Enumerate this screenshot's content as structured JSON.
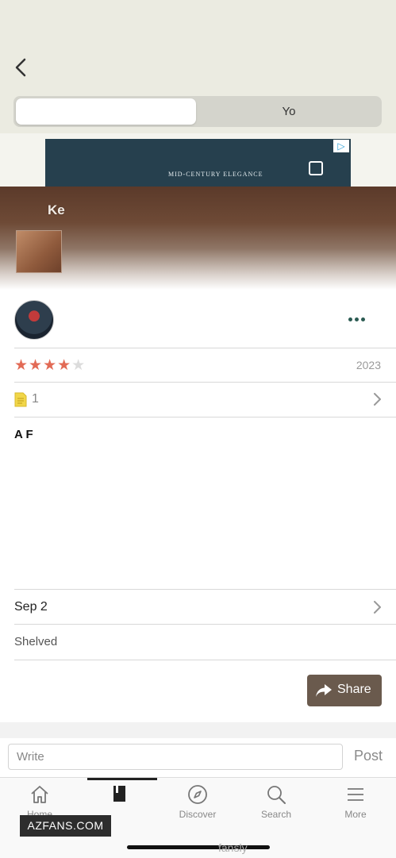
{
  "header": {
    "segments": [
      "",
      "Yo"
    ]
  },
  "ad": {
    "tagline": "MID-CENTURY ELEGANCE",
    "line_left": "",
    "brand": "",
    "info_glyph": "▷"
  },
  "book": {
    "title": "Ke"
  },
  "review": {
    "rating": 4,
    "max_rating": 5,
    "stars_on": "★★★★",
    "stars_off": "★",
    "date": "2023",
    "notes_count": "1",
    "title": "A F",
    "body": ""
  },
  "reading": {
    "progress_text": "Sep 2",
    "shelved_text": "Shelved"
  },
  "share": {
    "label": "Share"
  },
  "comment": {
    "placeholder": "Write",
    "post_label": "Post"
  },
  "tabs": [
    {
      "label": "Home",
      "icon": "home-icon"
    },
    {
      "label": "",
      "icon": "book-icon"
    },
    {
      "label": "Discover",
      "icon": "compass-icon"
    },
    {
      "label": "Search",
      "icon": "search-icon"
    },
    {
      "label": "More",
      "icon": "menu-icon"
    }
  ],
  "watermark": {
    "text": "AZFANS.COM",
    "footer": "fansly"
  },
  "colors": {
    "header_bg": "#ebebe1",
    "star": "#e26a55",
    "share_bg": "#6a5a4d",
    "more_dots": "#2b5b52"
  }
}
